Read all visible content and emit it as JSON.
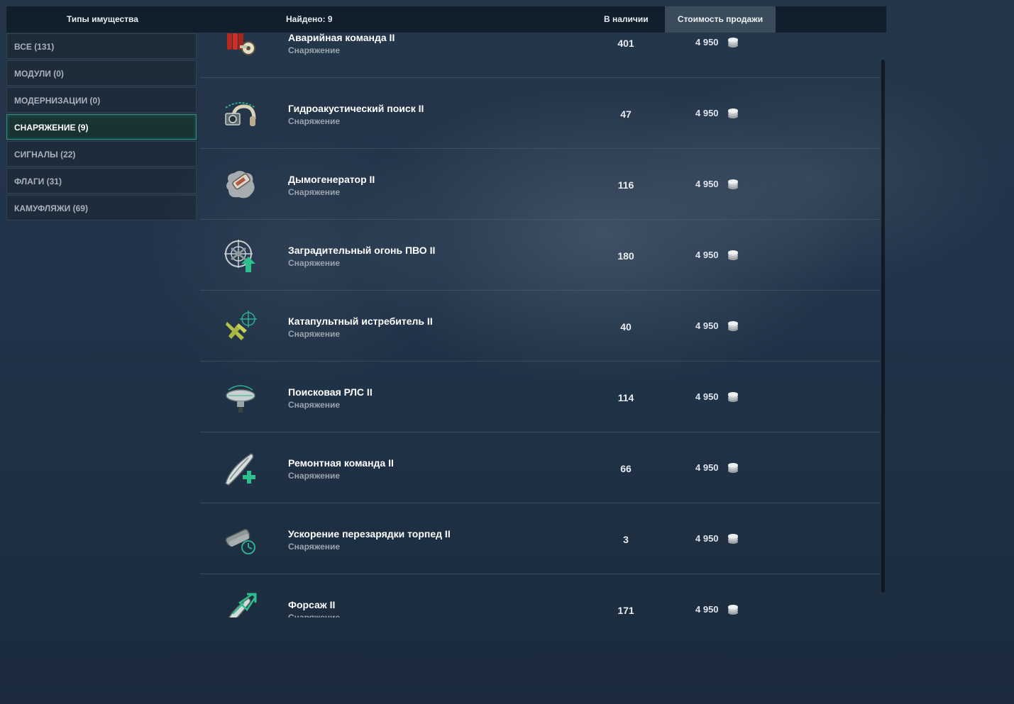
{
  "header": {
    "types_label": "Типы имущества",
    "found_label": "Найдено: 9",
    "stock_label": "В наличии",
    "price_label": "Стоимость продажи"
  },
  "sidebar": {
    "items": [
      {
        "label": "ВСЕ (131)",
        "active": false
      },
      {
        "label": "МОДУЛИ (0)",
        "active": false
      },
      {
        "label": "МОДЕРНИЗАЦИИ (0)",
        "active": false
      },
      {
        "label": "СНАРЯЖЕНИЕ (9)",
        "active": true
      },
      {
        "label": "СИГНАЛЫ (22)",
        "active": false
      },
      {
        "label": "ФЛАГИ (31)",
        "active": false
      },
      {
        "label": "КАМУФЛЯЖИ (69)",
        "active": false
      }
    ]
  },
  "items": [
    {
      "name": "Аварийная команда II",
      "type": "Снаряжение",
      "stock": "401",
      "price": "4 950",
      "icon": "damage-control-icon"
    },
    {
      "name": "Гидроакустический поиск II",
      "type": "Снаряжение",
      "stock": "47",
      "price": "4 950",
      "icon": "hydroacoustic-search-icon"
    },
    {
      "name": "Дымогенератор II",
      "type": "Снаряжение",
      "stock": "116",
      "price": "4 950",
      "icon": "smoke-generator-icon"
    },
    {
      "name": "Заградительный огонь ПВО II",
      "type": "Снаряжение",
      "stock": "180",
      "price": "4 950",
      "icon": "defensive-aa-fire-icon"
    },
    {
      "name": "Катапультный истребитель II",
      "type": "Снаряжение",
      "stock": "40",
      "price": "4 950",
      "icon": "catapult-fighter-icon"
    },
    {
      "name": "Поисковая РЛС II",
      "type": "Снаряжение",
      "stock": "114",
      "price": "4 950",
      "icon": "surveillance-radar-icon"
    },
    {
      "name": "Ремонтная команда II",
      "type": "Снаряжение",
      "stock": "66",
      "price": "4 950",
      "icon": "repair-party-icon"
    },
    {
      "name": "Ускорение перезарядки торпед II",
      "type": "Снаряжение",
      "stock": "3",
      "price": "4 950",
      "icon": "torpedo-reload-booster-icon"
    },
    {
      "name": "Форсаж II",
      "type": "Снаряжение",
      "stock": "171",
      "price": "4 950",
      "icon": "engine-boost-icon"
    }
  ],
  "currency_icon": "credits-coin-icon",
  "colors": {
    "accent_active": "#2f8f7e",
    "price_tab": "#3a4b5b",
    "secondary_text": "#9aa4ad"
  }
}
